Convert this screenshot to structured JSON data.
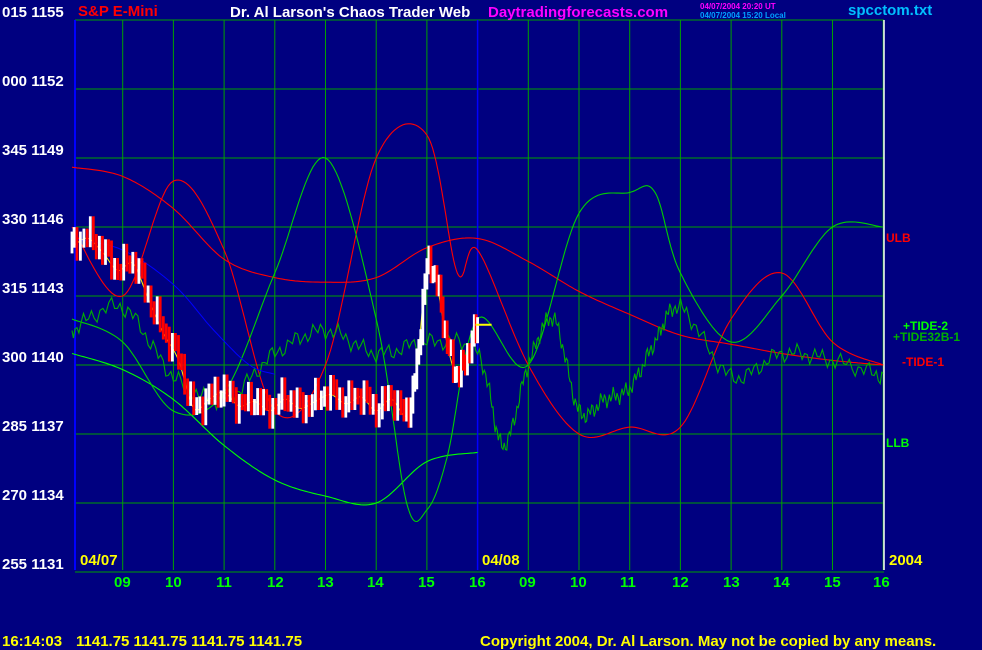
{
  "header": {
    "instrument": "S&P E-Mini",
    "title": "Dr. Al Larson's Chaos Trader Web",
    "site": "Daytradingforecasts.com",
    "datetime_ut": "04/07/2004 20:20 UT",
    "datetime_local": "04/07/2004 15:20 Local",
    "file": "spcctom.txt"
  },
  "left_axis": {
    "labels": [
      "015 1155",
      "000 1152",
      "345 1149",
      "330 1146",
      "315 1143",
      "300 1140",
      "285 1137",
      "270 1134",
      "255 1131"
    ]
  },
  "dates": {
    "first": "04/07",
    "second": "04/08",
    "year": "2004"
  },
  "x_ticks": [
    "09",
    "10",
    "11",
    "12",
    "13",
    "14",
    "15",
    "16",
    "09",
    "10",
    "11",
    "12",
    "13",
    "14",
    "15",
    "16"
  ],
  "right_labels": {
    "ulb": "ULB",
    "llb": "LLB",
    "tide2": "+TIDE-2",
    "tide32b": "+TIDE32B-1",
    "tide1": "-TIDE-1"
  },
  "footer": {
    "time": "16:14:03",
    "ohlc": "1141.75 1141.75 1141.75 1141.75",
    "copyright": "Copyright 2004, Dr. Al Larson. May not be copied by any means."
  },
  "colors": {
    "background": "#000080",
    "grid": "#00a000",
    "price_up": "#ffffff",
    "price_down": "#ff0000",
    "tide_red": "#ff0000",
    "tide_green": "#00d000",
    "ulb": "#ff0000",
    "llb": "#00ff00",
    "ma_yellow": "#ffff00",
    "ma_blue": "#0000ff",
    "left_labels": "#ffffff",
    "ticks": "#00ff00",
    "title_text": "#ffffff",
    "site_text": "#ff00ff",
    "instrument_text": "#ff0000",
    "file_text": "#00c0ff"
  },
  "chart_data": {
    "type": "line",
    "ylim": [
      1131,
      1155
    ],
    "y_ticks": [
      1131,
      1134,
      1137,
      1140,
      1143,
      1146,
      1149,
      1152,
      1155
    ],
    "x_range_hours": [
      8,
      16
    ],
    "price_series": {
      "name": "",
      "x": [
        8.0,
        8.3,
        8.6,
        8.9,
        9.2,
        9.5,
        9.8,
        10.1,
        10.4,
        10.7,
        11.0,
        11.3,
        11.6,
        11.9,
        12.2,
        12.5,
        12.8,
        13.1,
        13.4,
        13.7,
        14.0,
        14.3,
        14.6,
        14.8,
        15.0,
        15.2,
        15.4,
        15.6,
        15.8,
        16.0
      ],
      "y": [
        1145.2,
        1145.6,
        1145.0,
        1144.2,
        1144.5,
        1143.0,
        1141.5,
        1140.3,
        1138.2,
        1138.6,
        1138.9,
        1138.3,
        1138.5,
        1138.1,
        1138.6,
        1138.2,
        1138.5,
        1138.8,
        1138.4,
        1138.7,
        1138.1,
        1138.6,
        1137.9,
        1140.0,
        1144.2,
        1143.5,
        1141.0,
        1139.6,
        1140.5,
        1141.75
      ]
    },
    "series": [
      {
        "name": "ULB",
        "x": [
          8.0,
          9.0,
          10.0,
          11.0,
          12.0,
          13.0,
          14.0,
          15.0,
          16.0,
          17.0,
          18.0,
          19.0,
          20.0,
          21.0,
          22.0,
          23.0,
          24.0
        ],
        "y": [
          1148.6,
          1148.2,
          1146.8,
          1144.6,
          1143.8,
          1143.6,
          1143.8,
          1145.1,
          1145.5,
          1144.5,
          1143.2,
          1142.2,
          1141.3,
          1140.9,
          1140.5,
          1140.2,
          1140.0
        ]
      },
      {
        "name": "LLB",
        "x": [
          8.0,
          9.0,
          10.0,
          11.0,
          12.0,
          13.0,
          14.0,
          15.0,
          16.0
        ],
        "y": [
          1140.5,
          1139.8,
          1138.5,
          1136.5,
          1135.0,
          1134.3,
          1134.0,
          1135.8,
          1136.2
        ]
      },
      {
        "name": "TIDE-1",
        "x": [
          8.0,
          9.0,
          10.0,
          11.0,
          12.0,
          13.0,
          14.0,
          15.0,
          15.6,
          16.0,
          17.0,
          18.0,
          19.0,
          20.0,
          21.0,
          22.0,
          23.0,
          24.0
        ],
        "y": [
          1146.0,
          1143.0,
          1148.0,
          1145.0,
          1138.0,
          1140.0,
          1149.0,
          1150.0,
          1144.0,
          1145.0,
          1140.0,
          1137.0,
          1137.3,
          1137.3,
          1142.0,
          1144.0,
          1141.0,
          1140.0
        ]
      },
      {
        "name": "TIDE-2",
        "x": [
          8.0,
          9.0,
          10.0,
          11.0,
          12.0,
          13.0,
          14.0,
          14.6,
          15.0,
          15.4,
          16.0,
          17.0,
          18.0,
          19.0,
          19.5,
          20.0,
          21.0,
          22.0,
          23.0,
          24.0
        ],
        "y": [
          1142.0,
          1141.0,
          1138.0,
          1138.8,
          1144.0,
          1149.0,
          1142.0,
          1134.0,
          1133.7,
          1136.0,
          1142.0,
          1140.0,
          1146.6,
          1147.5,
          1147.5,
          1144.0,
          1141.0,
          1143.0,
          1146.0,
          1146.0
        ]
      },
      {
        "name": "TIDE32B-1",
        "x": [
          8.0,
          9.0,
          10.0,
          11.0,
          12.0,
          13.0,
          14.0,
          15.0,
          16.0,
          16.5,
          17.0,
          17.5,
          18.0,
          18.5,
          19.0,
          19.5,
          20.0,
          21.0,
          22.0,
          23.0,
          24.0
        ],
        "y": [
          1141.5,
          1142.5,
          1139.5,
          1138.5,
          1140.5,
          1141.5,
          1140.5,
          1141.0,
          1140.5,
          1136.5,
          1140.0,
          1142.0,
          1138.0,
          1138.5,
          1139.0,
          1141.0,
          1142.5,
          1139.5,
          1140.5,
          1140.2,
          1139.5
        ]
      }
    ]
  }
}
